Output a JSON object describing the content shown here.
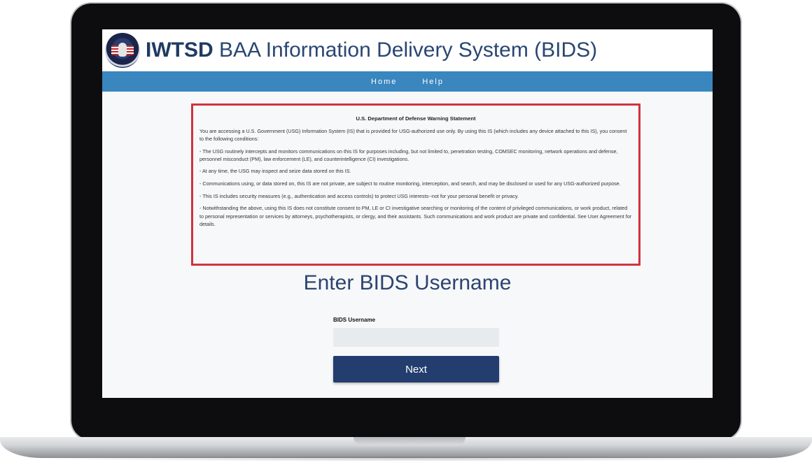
{
  "header": {
    "title_bold": "IWTSD",
    "title_rest": "BAA Information Delivery System (BIDS)"
  },
  "nav": {
    "items": [
      "Home",
      "Help"
    ]
  },
  "warning": {
    "heading": "U.S. Department of Defense Warning Statement",
    "paragraphs": [
      "You are accessing a U.S. Government (USG) Information System (IS) that is provided for USG-authorized use only. By using this IS (which includes any device attached to this IS), you consent to the following conditions:",
      "- The USG routinely intercepts and monitors communications on this IS for purposes including, but not limited to, penetration testing, COMSEC monitoring, network operations and defense, personnel misconduct (PM), law enforcement (LE), and counterintelligence (CI) investigations.",
      "- At any time, the USG may inspect and seize data stored on this IS.",
      "- Communications using, or data stored on, this IS are not private, are subject to routine monitoring, interception, and search, and may be disclosed or used for any USG-authorized purpose.",
      "- This IS includes security measures (e.g., authentication and access controls) to protect USG interests--not for your personal benefit or privacy.",
      "- Notwithstanding the above, using this IS does not constitute consent to PM, LE or CI investigative searching or monitoring of the content of privileged communications, or work product, related to personal representation or services by attorneys, psychotherapists, or clergy, and their assistants. Such communications and work product are private and confidential. See User Agreement for details."
    ]
  },
  "form": {
    "title": "Enter BIDS Username",
    "username_label": "BIDS Username",
    "username_value": "",
    "next_label": "Next"
  },
  "colors": {
    "nav_bar": "#3a86bf",
    "title_text": "#1f3b64",
    "warning_border": "#d0343f",
    "button": "#223d6e"
  },
  "icons": {
    "logo": "agency-seal-icon"
  }
}
